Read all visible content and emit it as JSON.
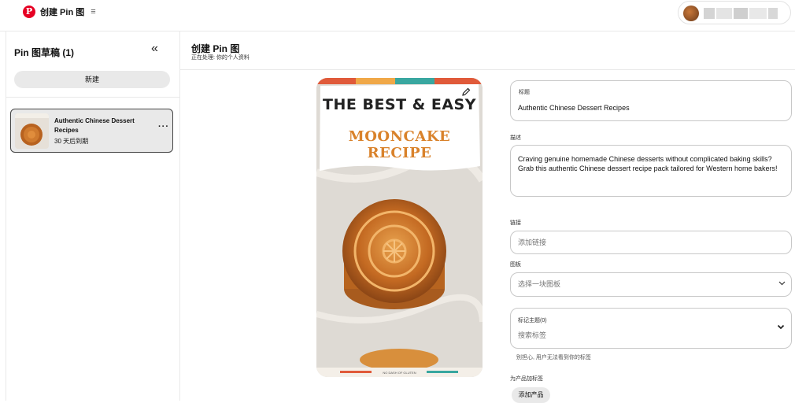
{
  "header": {
    "app_title": "创建 Pin 图",
    "menu_icon": "≡"
  },
  "sidebar": {
    "title": "Pin 图草稿 (1)",
    "collapse_icon": "«",
    "new_button": "新建",
    "drafts": [
      {
        "title": "Authentic Chinese Dessert Recipes",
        "expiry": "30 天后到期",
        "more_icon": "···"
      }
    ]
  },
  "main": {
    "title": "创建 Pin 图",
    "subtitle": "正在处理: 你的个人资料"
  },
  "pin_image": {
    "headline_line1": "THE BEST & EASY",
    "headline_line2": "MOONCAKE RECIPE",
    "watermark": "NO DASH OF GLUTEN"
  },
  "form": {
    "title_label": "标题",
    "title_value": "Authentic Chinese Dessert Recipes",
    "description_label": "描述",
    "description_value": "Craving genuine homemade Chinese desserts without complicated baking skills? Grab this authentic Chinese dessert recipe pack tailored for Western home bakers!",
    "link_label": "链接",
    "link_placeholder": "添加链接",
    "board_label": "图板",
    "board_placeholder": "选择一块图板",
    "tags_label": "标记主题(0)",
    "tags_placeholder": "搜索标签",
    "tags_helper": "别担心, 用户无法看到你的标签",
    "product_label": "为产品加标签",
    "add_product_button": "添加产品"
  },
  "colors": {
    "brand": "#e60023",
    "mooncake_text": "#d9822b",
    "card_bg": "#e9e9e9"
  }
}
